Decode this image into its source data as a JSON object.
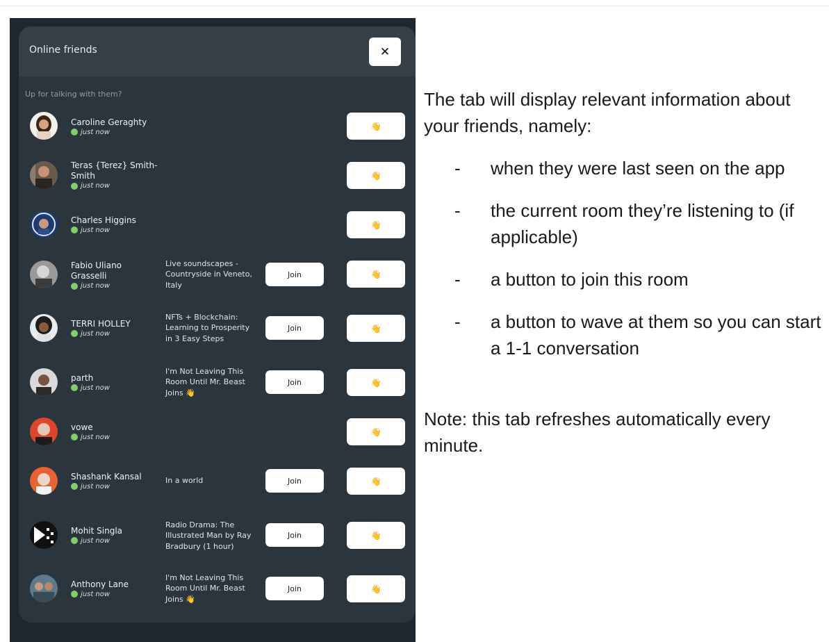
{
  "panel": {
    "title": "Online friends",
    "close_icon": "close-icon",
    "close_glyph": "✕",
    "subtitle": "Up for talking with them?"
  },
  "friends": [
    {
      "name": "Caroline Geraghty",
      "status": "just now",
      "room": "",
      "join_label": "",
      "wave_emoji": "👋"
    },
    {
      "name": "Teras {Terez} Smith-Smith",
      "status": "just now",
      "room": "",
      "join_label": "",
      "wave_emoji": "👋"
    },
    {
      "name": "Charles Higgins",
      "status": "just now",
      "room": "",
      "join_label": "",
      "wave_emoji": "👋"
    },
    {
      "name": "Fabio Uliano Grasselli",
      "status": "just now",
      "room": "Live soundscapes - Countryside in Veneto, Italy",
      "join_label": "Join",
      "wave_emoji": "👋"
    },
    {
      "name": "TERRI HOLLEY",
      "status": "just now",
      "room": "NFTs + Blockchain: Learning to Prosperity in 3 Easy Steps",
      "join_label": "Join",
      "wave_emoji": "👋"
    },
    {
      "name": "parth",
      "status": "just now",
      "room": "I'm Not Leaving This Room Until Mr. Beast Joins 👋",
      "join_label": "Join",
      "wave_emoji": "👋"
    },
    {
      "name": "vowe",
      "status": "just now",
      "room": "",
      "join_label": "",
      "wave_emoji": "👋"
    },
    {
      "name": "Shashank Kansal",
      "status": "just now",
      "room": "In a world",
      "join_label": "Join",
      "wave_emoji": "👋"
    },
    {
      "name": "Mohit Singla",
      "status": "just now",
      "room": "Radio Drama: The Illustrated Man by Ray Bradbury (1 hour)",
      "join_label": "Join",
      "wave_emoji": "👋"
    },
    {
      "name": "Anthony Lane",
      "status": "just now",
      "room": "I'm Not Leaving This Room Until Mr. Beast Joins 👋",
      "join_label": "Join",
      "wave_emoji": "👋"
    }
  ],
  "description": {
    "intro": "The tab will display relevant information about your friends, namely:",
    "bullets": [
      "when they were last seen on the app",
      "the current room they’re listening to (if applicable)",
      "a button to join this room",
      "a button to wave at them so you can start a 1-1 conversation"
    ],
    "bullet_marker": "-",
    "note": "Note: this tab refreshes automatically every minute."
  },
  "colors": {
    "panel_bg": "#2b353d",
    "header_bg": "#343f48",
    "online_dot": "#7ed06a",
    "button_bg": "#ffffff"
  }
}
